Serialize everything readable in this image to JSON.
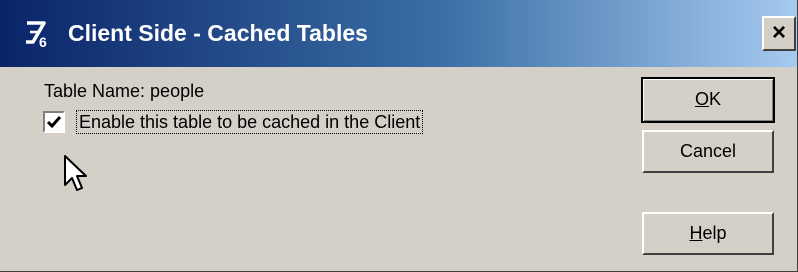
{
  "window": {
    "title": "Client Side - Cached Tables",
    "close_label": "×"
  },
  "content": {
    "table_name_label": "Table Name: people",
    "cache_checkbox": {
      "label": "Enable this table to be cached in the Client",
      "checked": true
    }
  },
  "buttons": {
    "ok": {
      "label_ul": "O",
      "label_rest": "K"
    },
    "cancel": {
      "label": "Cancel"
    },
    "help": {
      "label_ul": "H",
      "label_rest": "elp"
    }
  },
  "colors": {
    "title_gradient_start": "#0a246a",
    "title_gradient_end": "#a6caf0",
    "face": "#d4d0c8"
  },
  "icons": {
    "app": "z6-app-icon",
    "cursor": "mouse-pointer-icon",
    "check": "checkmark-icon"
  }
}
